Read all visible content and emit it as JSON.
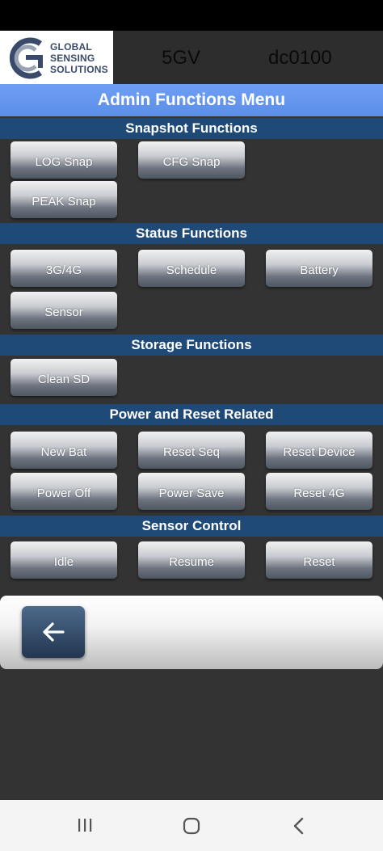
{
  "header": {
    "logo": {
      "line1": "GLOBAL",
      "line2": "SENSING",
      "line3": "SOLUTIONS"
    },
    "info1": "5GV",
    "info2": "dc0100"
  },
  "menu_title": "Admin Functions Menu",
  "sections": {
    "snapshot": {
      "title": "Snapshot Functions",
      "buttons": [
        "LOG Snap",
        "CFG Snap",
        "PEAK Snap"
      ]
    },
    "status": {
      "title": "Status Functions",
      "buttons": [
        "3G/4G",
        "Schedule",
        "Battery",
        "Sensor"
      ]
    },
    "storage": {
      "title": "Storage Functions",
      "buttons": [
        "Clean SD"
      ]
    },
    "power": {
      "title": "Power and Reset Related",
      "buttons": [
        "New Bat",
        "Reset Seq",
        "Reset Device",
        "Power Off",
        "Power Save",
        "Reset 4G"
      ]
    },
    "sensor": {
      "title": "Sensor Control",
      "buttons": [
        "Idle",
        "Resume",
        "Reset"
      ]
    }
  },
  "icons": {
    "back": "arrow-left-icon",
    "recent_apps": "recent-apps-icon",
    "home": "home-icon",
    "system_back": "chevron-left-icon"
  },
  "colors": {
    "background": "#333333",
    "title_bar": "#6699ff",
    "section_header": "#1f4a78",
    "button_text": "#ffffff"
  }
}
